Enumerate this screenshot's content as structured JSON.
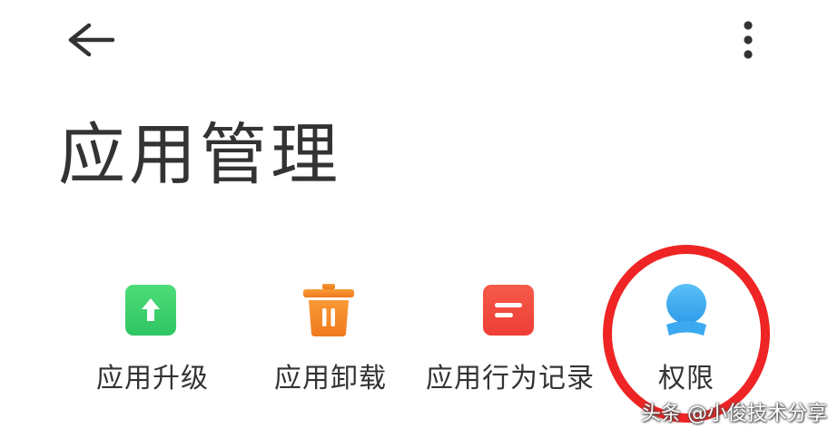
{
  "header": {
    "back_icon": "arrow-left-icon",
    "more_icon": "more-vertical-icon"
  },
  "page": {
    "title": "应用管理"
  },
  "actions": [
    {
      "label": "应用升级",
      "icon": "upgrade-arrow-icon",
      "color": "#3bd16f"
    },
    {
      "label": "应用卸载",
      "icon": "trash-icon",
      "color": "#f5862a"
    },
    {
      "label": "应用行为记录",
      "icon": "record-list-icon",
      "color": "#f2473d"
    },
    {
      "label": "权限",
      "icon": "permission-user-icon",
      "color": "#3aa9f0"
    }
  ],
  "annotation": {
    "highlight_color": "#ef2424"
  },
  "watermark": {
    "text": "头条 @小俊技术分享"
  }
}
